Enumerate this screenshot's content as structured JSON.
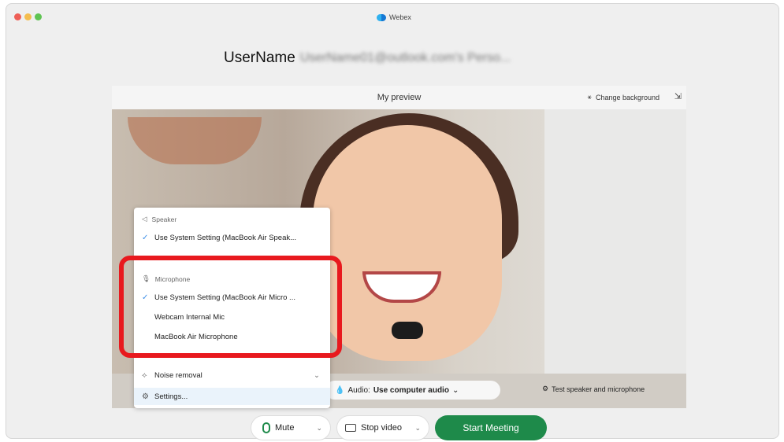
{
  "window": {
    "app_title": "Webex",
    "meeting_title_name": "UserName",
    "meeting_title_blurred": "UserName01@outlook.com's Perso..."
  },
  "preview": {
    "title": "My preview",
    "change_background": "Change background"
  },
  "audio_menu": {
    "speaker_section": "Speaker",
    "speaker_option": "Use System Setting (MacBook Air Speak...",
    "microphone_section": "Microphone",
    "mic_options": [
      "Use System Setting (MacBook Air Micro ...",
      "Webcam Internal Mic",
      "MacBook Air Microphone"
    ],
    "noise_removal": "Noise removal",
    "settings": "Settings..."
  },
  "preview_bar": {
    "audio_label": "Audio:",
    "audio_value": "Use computer audio",
    "test_label": "Test speaker and microphone"
  },
  "controls": {
    "mute": "Mute",
    "stop_video": "Stop video",
    "start_meeting": "Start Meeting"
  },
  "colors": {
    "start_button": "#1e8a4a",
    "highlight": "#e8191e"
  }
}
